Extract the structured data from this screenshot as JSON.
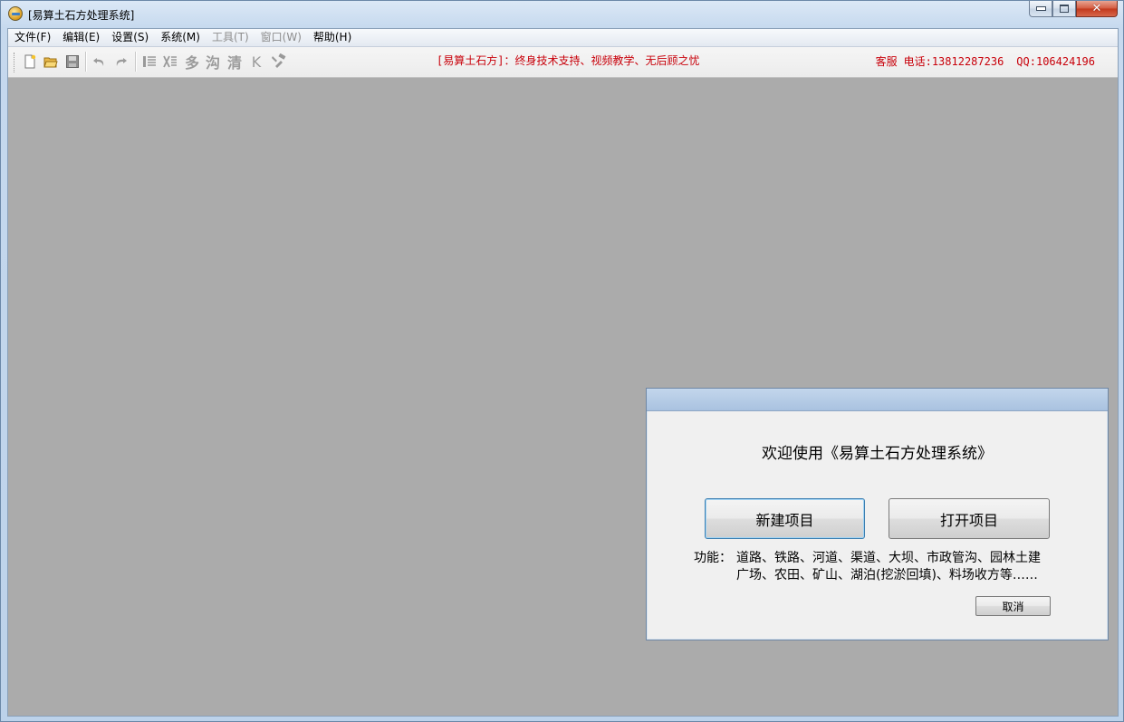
{
  "window": {
    "title": "[易算土石方处理系统]"
  },
  "menu": [
    {
      "label": "文件(F)",
      "enabled": true
    },
    {
      "label": "编辑(E)",
      "enabled": true
    },
    {
      "label": "设置(S)",
      "enabled": true
    },
    {
      "label": "系统(M)",
      "enabled": true
    },
    {
      "label": "工具(T)",
      "enabled": false
    },
    {
      "label": "窗口(W)",
      "enabled": false
    },
    {
      "label": "帮助(H)",
      "enabled": true
    }
  ],
  "toolbar": {
    "icons": [
      "new-file-icon",
      "open-folder-icon",
      "save-icon",
      "undo-icon",
      "redo-icon",
      "insert-row-icon",
      "delete-row-icon"
    ],
    "char_buttons": [
      "多",
      "沟",
      "清",
      "K"
    ],
    "tools_icon": "tools-icon",
    "marquee": "[易算土石方]：终身技术支持、视频教学、无后顾之忧",
    "service": "客服",
    "phone": "电话:13812287236",
    "qq": "QQ:106424196"
  },
  "dialog": {
    "welcome": "欢迎使用《易算土石方处理系统》",
    "new_project": "新建项目",
    "open_project": "打开项目",
    "features_label": "功能：",
    "features_line1": "道路、铁路、河道、渠道、大坝、市政管沟、园林土建",
    "features_line2": "广场、农田、矿山、湖泊(挖淤回填)、料场收方等……",
    "cancel": "取消"
  }
}
